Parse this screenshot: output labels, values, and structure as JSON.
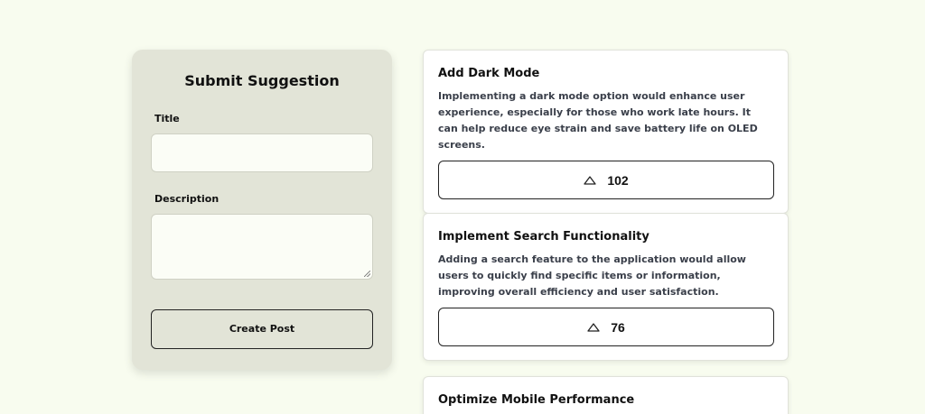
{
  "form": {
    "title": "Submit Suggestion",
    "title_label": "Title",
    "title_value": "",
    "description_label": "Description",
    "description_value": "",
    "submit_label": "Create Post"
  },
  "posts": [
    {
      "title": "Add Dark Mode",
      "description": "Implementing a dark mode option would enhance user experience, especially for those who work late hours. It can help reduce eye strain and save battery life on OLED screens.",
      "votes": "102",
      "vote_icon": "chevron-up-icon"
    },
    {
      "title": "Implement Search Functionality",
      "description": "Adding a search feature to the application would allow users to quickly find specific items or information, improving overall efficiency and user satisfaction.",
      "votes": "76",
      "vote_icon": "chevron-up-icon"
    },
    {
      "title": "Optimize Mobile Performance"
    }
  ],
  "colors": {
    "page_background": "#f8fcef",
    "form_background": "#e2e4d7",
    "card_background": "#ffffff",
    "border_dark": "#222222",
    "description_text": "#3a3f4a"
  }
}
